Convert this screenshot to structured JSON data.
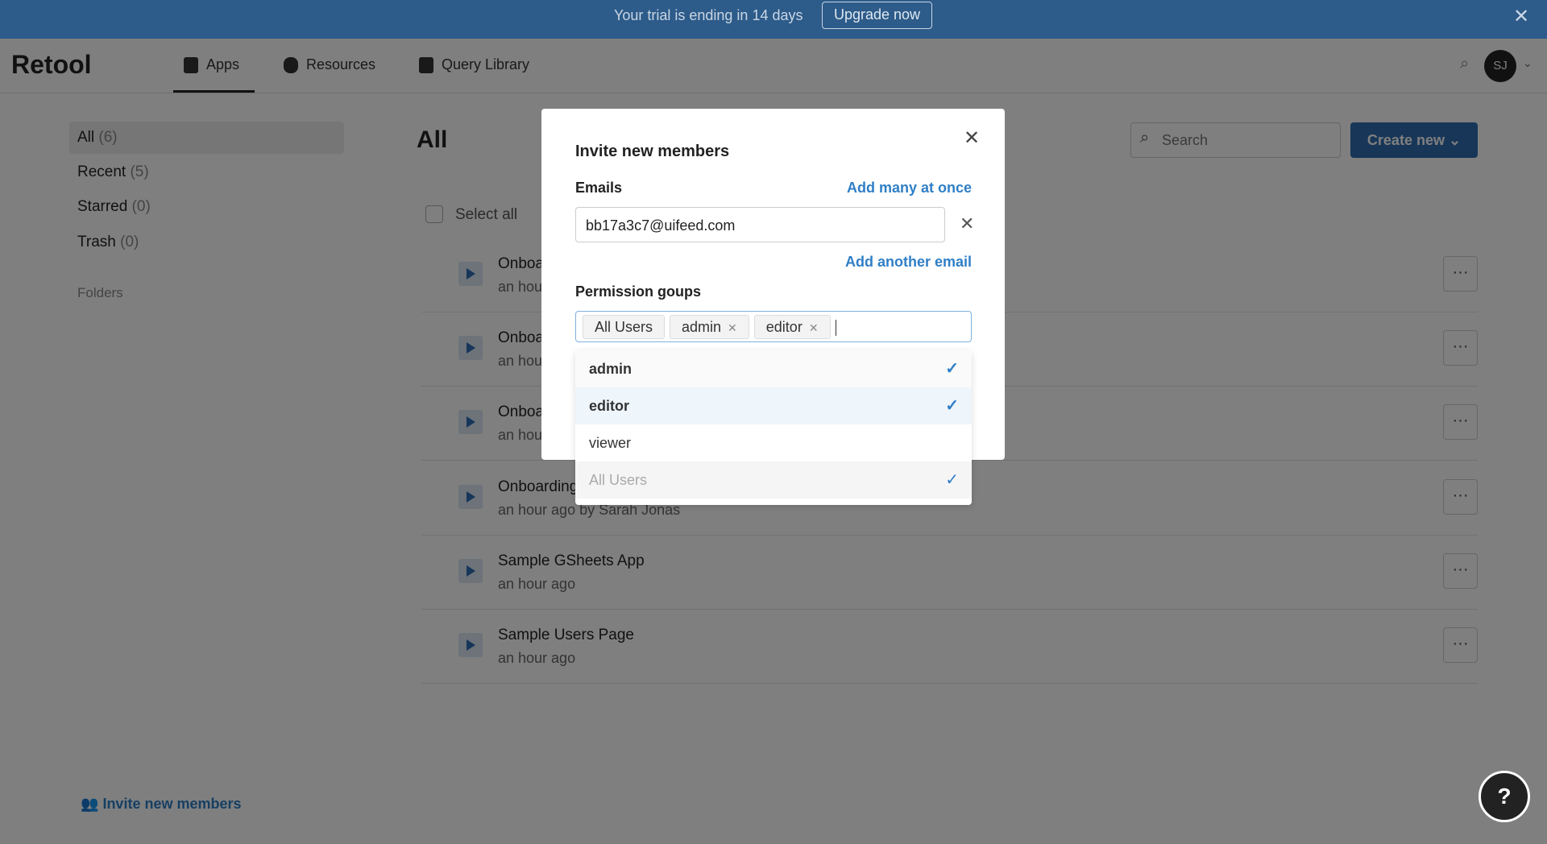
{
  "banner": {
    "message": "Your trial is ending in 14 days",
    "upgrade": "Upgrade now"
  },
  "nav": {
    "logo": "Retool",
    "items": [
      {
        "label": "Apps"
      },
      {
        "label": "Resources"
      },
      {
        "label": "Query Library"
      }
    ],
    "avatar": "SJ"
  },
  "sidebar": {
    "items": [
      {
        "label": "All",
        "count": "(6)"
      },
      {
        "label": "Recent",
        "count": "(5)"
      },
      {
        "label": "Starred",
        "count": "(0)"
      },
      {
        "label": "Trash",
        "count": "(0)"
      }
    ],
    "folders": "Folders",
    "invite": "Invite new members"
  },
  "main": {
    "title": "All",
    "search_placeholder": "Search",
    "create": "Create new",
    "select_all": "Select all",
    "apps": [
      {
        "name": "Onboarding",
        "sub": "an hour ago"
      },
      {
        "name": "Onboarding",
        "sub": "an hour ago"
      },
      {
        "name": "Onboarding",
        "sub": "an hour ago"
      },
      {
        "name": "Onboarding",
        "sub": "an hour ago by Sarah Jonas"
      },
      {
        "name": "Sample GSheets App",
        "sub": "an hour ago"
      },
      {
        "name": "Sample Users Page",
        "sub": "an hour ago"
      }
    ]
  },
  "modal": {
    "title": "Invite new members",
    "emails_label": "Emails",
    "add_many": "Add many at once",
    "email_value": "bb17a3c7@uifeed.com",
    "add_another": "Add another email",
    "perm_label": "Permission goups",
    "tags": [
      "All Users",
      "admin",
      "editor"
    ],
    "options": [
      {
        "label": "admin",
        "checked": true
      },
      {
        "label": "editor",
        "checked": true
      },
      {
        "label": "viewer",
        "checked": false
      },
      {
        "label": "All Users",
        "checked": true
      }
    ]
  },
  "colors": {
    "banner": "#2d5b8a",
    "accent": "#2f7fc7"
  }
}
